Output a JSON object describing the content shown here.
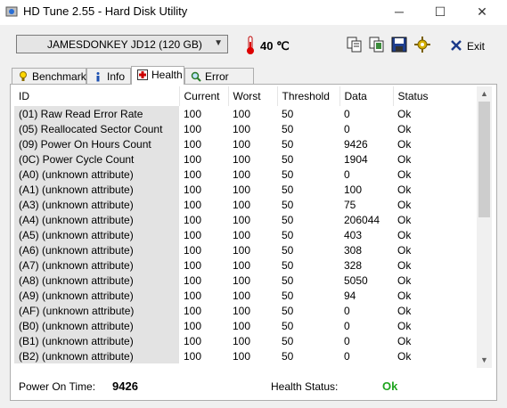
{
  "window": {
    "title": "HD Tune 2.55 - Hard Disk Utility",
    "minimize": "─",
    "maximize": "☐",
    "close": "✕"
  },
  "toolbar": {
    "drive": "JAMESDONKEY JD12 (120 GB)",
    "temperature": "40 ℃",
    "exit_label": "Exit"
  },
  "tabs": [
    {
      "label": "Benchmark",
      "icon": "benchmark-icon"
    },
    {
      "label": "Info",
      "icon": "info-icon"
    },
    {
      "label": "Health",
      "icon": "health-icon",
      "active": true
    },
    {
      "label": "Error Scan",
      "icon": "error-scan-icon"
    }
  ],
  "table": {
    "columns": [
      "ID",
      "Current",
      "Worst",
      "Threshold",
      "Data",
      "Status"
    ],
    "rows": [
      [
        "(01) Raw Read Error Rate",
        "100",
        "100",
        "50",
        "0",
        "Ok"
      ],
      [
        "(05) Reallocated Sector Count",
        "100",
        "100",
        "50",
        "0",
        "Ok"
      ],
      [
        "(09) Power On Hours Count",
        "100",
        "100",
        "50",
        "9426",
        "Ok"
      ],
      [
        "(0C) Power Cycle Count",
        "100",
        "100",
        "50",
        "1904",
        "Ok"
      ],
      [
        "(A0) (unknown attribute)",
        "100",
        "100",
        "50",
        "0",
        "Ok"
      ],
      [
        "(A1) (unknown attribute)",
        "100",
        "100",
        "50",
        "100",
        "Ok"
      ],
      [
        "(A3) (unknown attribute)",
        "100",
        "100",
        "50",
        "75",
        "Ok"
      ],
      [
        "(A4) (unknown attribute)",
        "100",
        "100",
        "50",
        "206044",
        "Ok"
      ],
      [
        "(A5) (unknown attribute)",
        "100",
        "100",
        "50",
        "403",
        "Ok"
      ],
      [
        "(A6) (unknown attribute)",
        "100",
        "100",
        "50",
        "308",
        "Ok"
      ],
      [
        "(A7) (unknown attribute)",
        "100",
        "100",
        "50",
        "328",
        "Ok"
      ],
      [
        "(A8) (unknown attribute)",
        "100",
        "100",
        "50",
        "5050",
        "Ok"
      ],
      [
        "(A9) (unknown attribute)",
        "100",
        "100",
        "50",
        "94",
        "Ok"
      ],
      [
        "(AF) (unknown attribute)",
        "100",
        "100",
        "50",
        "0",
        "Ok"
      ],
      [
        "(B0) (unknown attribute)",
        "100",
        "100",
        "50",
        "0",
        "Ok"
      ],
      [
        "(B1) (unknown attribute)",
        "100",
        "100",
        "50",
        "0",
        "Ok"
      ],
      [
        "(B2) (unknown attribute)",
        "100",
        "100",
        "50",
        "0",
        "Ok"
      ]
    ]
  },
  "status": {
    "power_on_label": "Power On Time:",
    "power_on_value": "9426",
    "health_label": "Health Status:",
    "health_value": "Ok"
  },
  "colors": {
    "ok_green": "#1fa51f",
    "id_column_bg": "#e3e3e3"
  }
}
